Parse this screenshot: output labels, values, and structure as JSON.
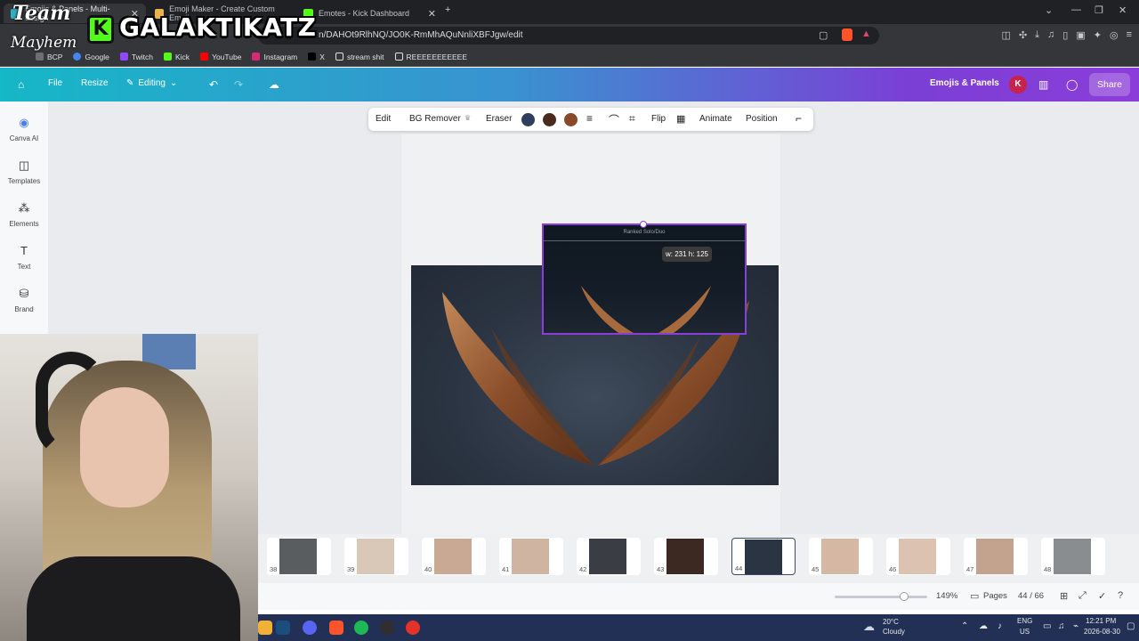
{
  "browser": {
    "tabs": [
      {
        "label": "Emojis & Panels - Multi-design",
        "active": true
      },
      {
        "label": "Emoji Maker - Create Custom Emoji",
        "active": false
      },
      {
        "label": "Emotes - Kick Dashboard",
        "active": false
      }
    ],
    "url": "n/DAHOt9RlhNQ/JO0K-RmMhAQuNnliXBFJgw/edit",
    "bookmarks": [
      "BCP",
      "Google",
      "Twitch",
      "Kick",
      "YouTube",
      "Instagram",
      "X",
      "stream shit",
      "REEEEEEEEEEE"
    ]
  },
  "overlay": {
    "team": "Team",
    "mayhem": "Mayhem",
    "kick_letter": "K",
    "channel": "GALAKTIKATZ"
  },
  "canva_header": {
    "file": "File",
    "resize": "Resize",
    "editing": "Editing",
    "doc_title": "Emojis & Panels",
    "avatar_letter": "K",
    "share": "Share"
  },
  "rail": [
    {
      "label": "Canva AI",
      "icon": "canva-ai-icon"
    },
    {
      "label": "Templates",
      "icon": "templates-icon"
    },
    {
      "label": "Elements",
      "icon": "elements-icon"
    },
    {
      "label": "Text",
      "icon": "text-icon"
    },
    {
      "label": "Brand",
      "icon": "brand-icon"
    }
  ],
  "toolbar": {
    "edit": "Edit",
    "bg_remover": "BG Remover",
    "eraser": "Eraser",
    "flip": "Flip",
    "animate": "Animate",
    "position": "Position",
    "swatches": [
      "#2f3e5c",
      "#4a2c1c",
      "#8a4a28"
    ]
  },
  "canvas": {
    "selected_title": "Ranked Solo/Duo",
    "dimension_tip": "w: 231 h: 125"
  },
  "filmstrip": {
    "pages": [
      {
        "num": "38",
        "color": "#5a5d60"
      },
      {
        "num": "39",
        "color": "#d9c8b8"
      },
      {
        "num": "40",
        "color": "#c9a894"
      },
      {
        "num": "41",
        "color": "#cfb4a2"
      },
      {
        "num": "42",
        "color": "#3b3d44"
      },
      {
        "num": "43",
        "color": "#3c2a22"
      },
      {
        "num": "44",
        "color": "#2b3442"
      },
      {
        "num": "45",
        "color": "#d4b8a4"
      },
      {
        "num": "46",
        "color": "#dcc2b1"
      },
      {
        "num": "47",
        "color": "#c3a28e"
      },
      {
        "num": "48",
        "color": "#8a8d90"
      }
    ],
    "active_page": "44"
  },
  "footer": {
    "zoom": "149%",
    "pages_label": "Pages",
    "page_count": "44 / 66",
    "zoom_level": 0.75
  },
  "taskbar": {
    "weather_temp": "20°C",
    "weather_desc": "Cloudy",
    "lang": "ENG",
    "region": "US",
    "time": "12:21 PM",
    "date": "2026-08-30"
  }
}
